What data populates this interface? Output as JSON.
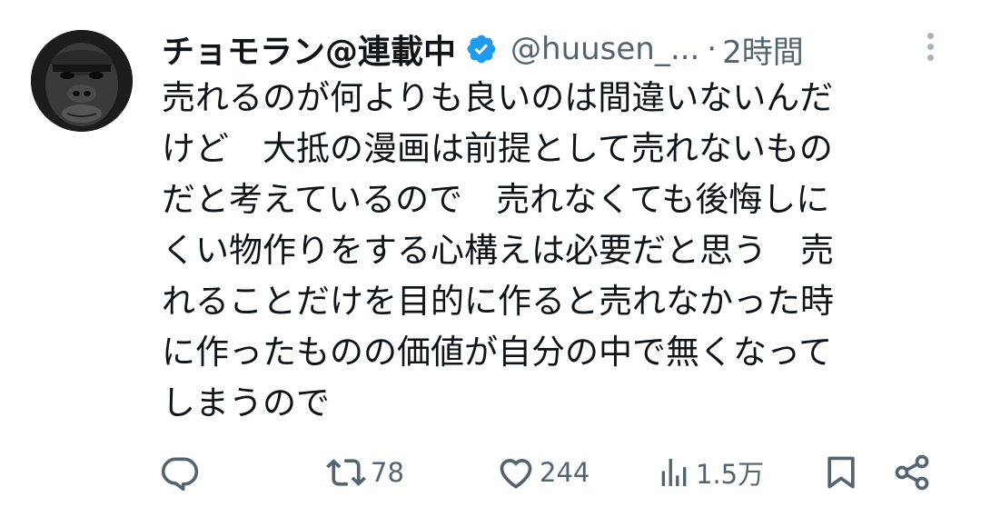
{
  "tweet": {
    "display_name": "チョモラン@連載中",
    "handle": "@huusen_...",
    "separator": "·",
    "time": "2時間",
    "body_lines": [
      "売れるのが何よりも良いのは間違いないんだ",
      "けど　大抵の漫画は前提として売れないもの",
      "だと考えているので　売れなくても後悔しに",
      "くい物作りをする心構えは必要だと思う　売",
      "れることだけを目的に作ると売れなかった時",
      "に作ったものの価値が自分の中で無くなって",
      "しまうので"
    ]
  },
  "actions": {
    "reply": {
      "icon": "reply-icon",
      "count": ""
    },
    "retweet": {
      "icon": "retweet-icon",
      "count": "78"
    },
    "like": {
      "icon": "heart-icon",
      "count": "244"
    },
    "views": {
      "icon": "views-icon",
      "count": "1.5万"
    },
    "bookmark": {
      "icon": "bookmark-icon",
      "count": ""
    },
    "share": {
      "icon": "share-icon",
      "count": ""
    }
  },
  "colors": {
    "text": "#0f1419",
    "secondary": "#536471",
    "verified": "#1d9bf0"
  }
}
